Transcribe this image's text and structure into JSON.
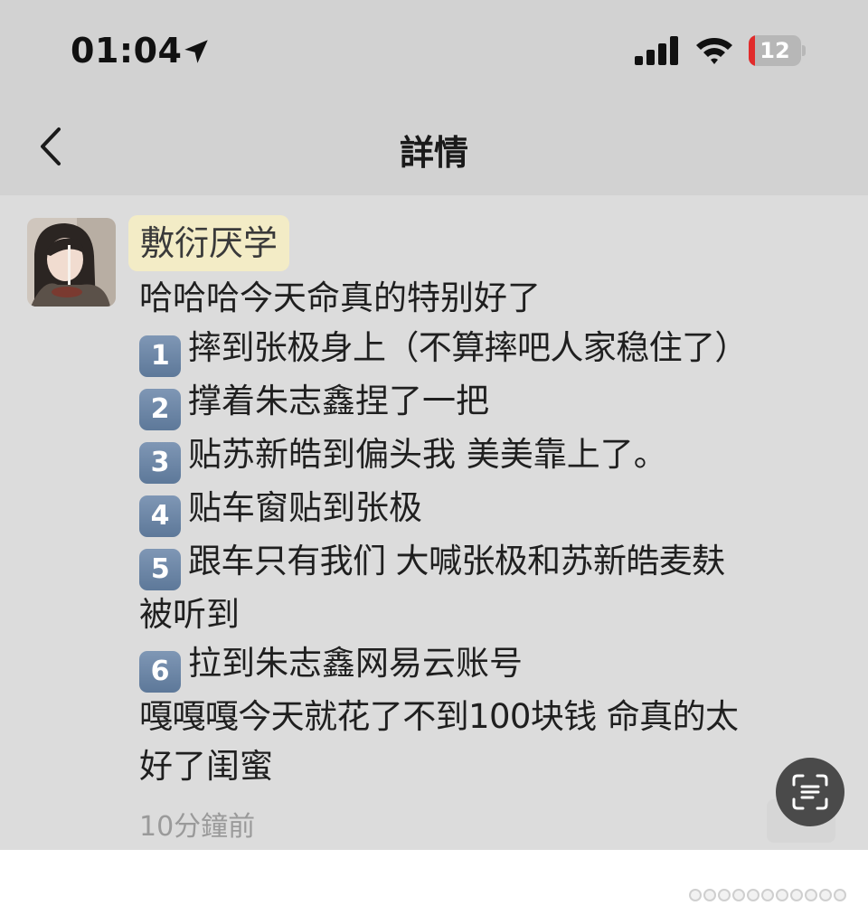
{
  "status_bar": {
    "time": "01:04",
    "battery_percent": "12",
    "battery_level": 0.12,
    "battery_color": "#e12b2b",
    "icons": [
      "location-arrow-icon",
      "cellular-signal-icon",
      "wifi-icon",
      "battery-icon"
    ]
  },
  "nav": {
    "back_icon": "chevron-left-icon",
    "title": "詳情"
  },
  "post": {
    "username": "敷衍厌学",
    "username_highlight": "#f3ecc6",
    "intro": "哈哈哈今天命真的特别好了",
    "items": [
      {
        "number": "1",
        "text": "摔到张极身上（不算摔吧人家稳住了）"
      },
      {
        "number": "2",
        "text": "撑着朱志鑫捏了一把"
      },
      {
        "number": "3",
        "text": "贴苏新皓到偏头我 美美靠上了。"
      },
      {
        "number": "4",
        "text": "贴车窗贴到张极"
      },
      {
        "number": "5",
        "text": "跟车只有我们 大喊张极和苏新皓麦麸",
        "continuation": "被听到"
      },
      {
        "number": "6",
        "text": "拉到朱志鑫网易云账号"
      }
    ],
    "outro_line1": "嘎嘎嘎今天就花了不到100块钱 命真的太",
    "outro_line2": "好了闺蜜",
    "timestamp": "10分鐘前"
  },
  "floating": {
    "scan_icon": "text-scan-icon"
  }
}
